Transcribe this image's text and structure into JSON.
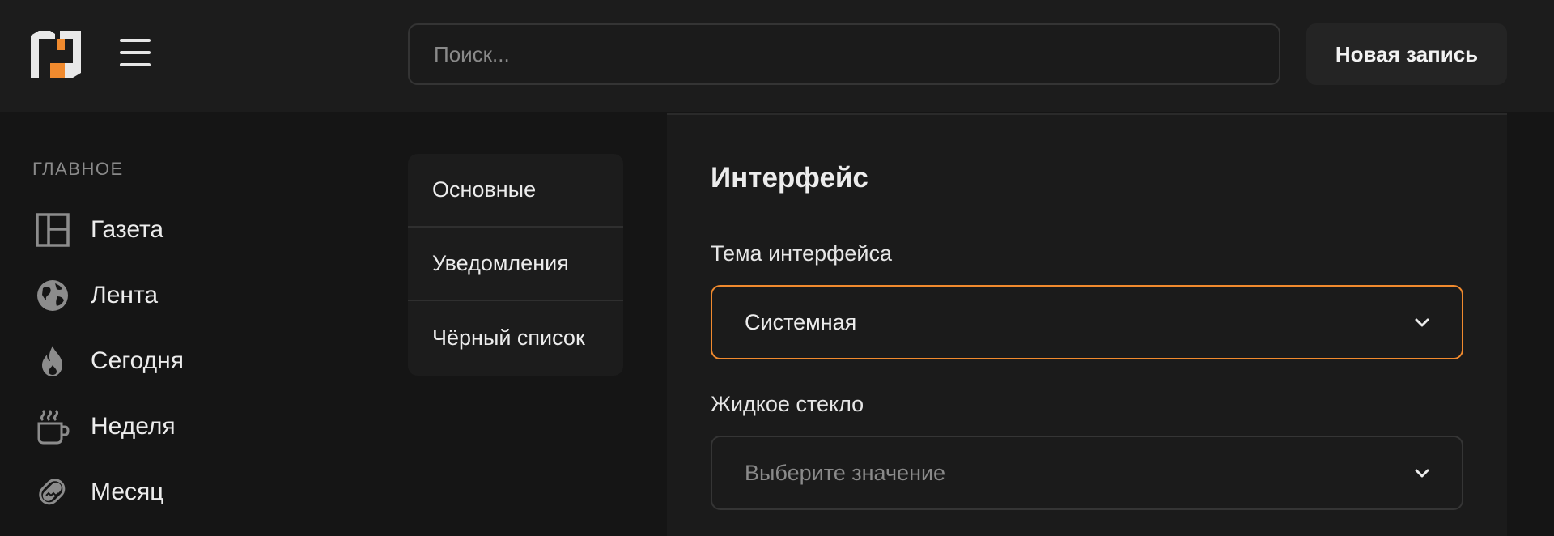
{
  "header": {
    "search_placeholder": "Поиск...",
    "new_post_label": "Новая запись"
  },
  "sidebar": {
    "section_title": "ГЛАВНОЕ",
    "items": [
      {
        "label": "Газета",
        "icon": "newspaper-layout-icon"
      },
      {
        "label": "Лента",
        "icon": "globe-icon"
      },
      {
        "label": "Сегодня",
        "icon": "flame-icon"
      },
      {
        "label": "Неделя",
        "icon": "coffee-cup-icon"
      },
      {
        "label": "Месяц",
        "icon": "hotdog-icon"
      }
    ]
  },
  "settings_tabs": [
    "Основные",
    "Уведомления",
    "Чёрный список"
  ],
  "panel": {
    "title": "Интерфейс",
    "theme": {
      "label": "Тема интерфейса",
      "value": "Системная"
    },
    "glass": {
      "label": "Жидкое стекло",
      "placeholder": "Выберите значение"
    }
  },
  "colors": {
    "accent": "#f08a2e",
    "background": "#151515",
    "surface": "#1c1c1c"
  }
}
